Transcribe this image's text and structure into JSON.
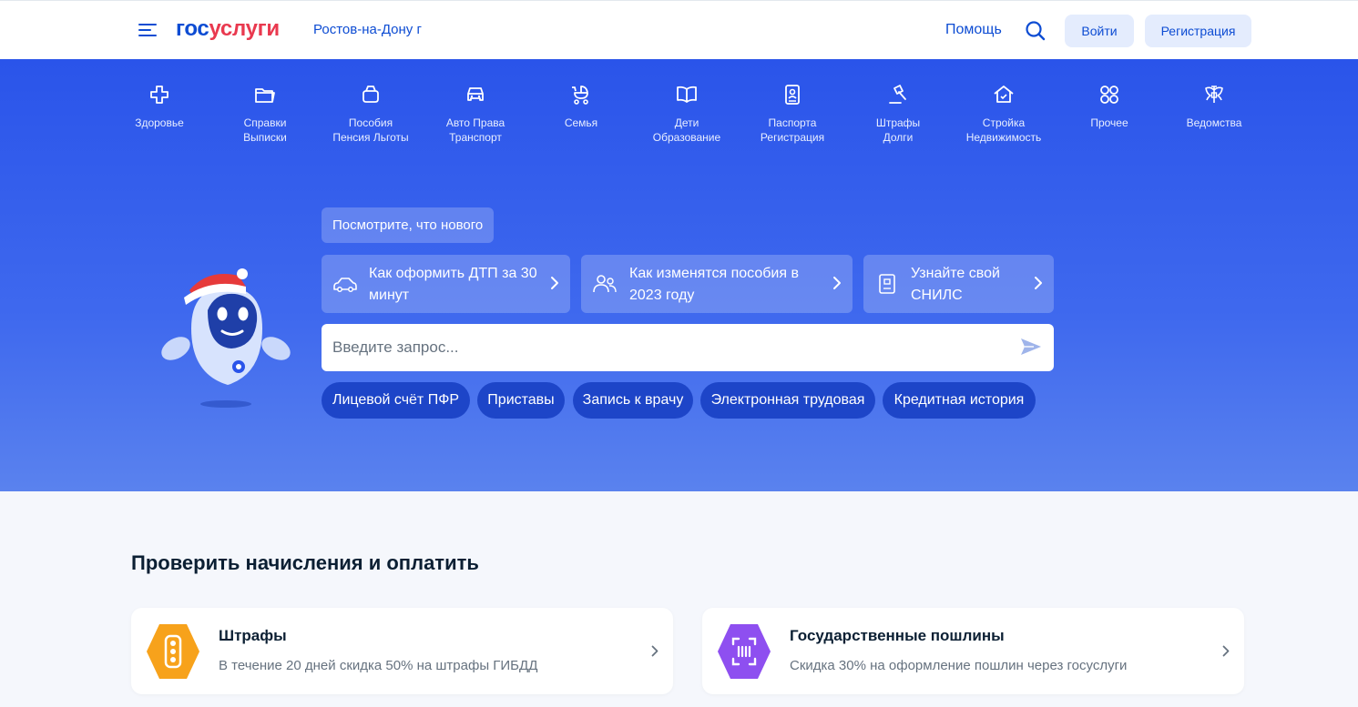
{
  "header": {
    "logo_part1": "гос",
    "logo_part2": "услуги",
    "city": "Ростов-на-Дону г",
    "help": "Помощь",
    "login": "Войти",
    "register": "Регистрация"
  },
  "categories": [
    {
      "line1": "Здоровье",
      "line2": "",
      "icon": "health-cross-icon"
    },
    {
      "line1": "Справки",
      "line2": "Выписки",
      "icon": "folder-icon"
    },
    {
      "line1": "Пособия",
      "line2": "Пенсия Льготы",
      "icon": "wallet-icon"
    },
    {
      "line1": "Авто Права",
      "line2": "Транспорт",
      "icon": "car-icon"
    },
    {
      "line1": "Семья",
      "line2": "",
      "icon": "stroller-icon"
    },
    {
      "line1": "Дети",
      "line2": "Образование",
      "icon": "book-icon"
    },
    {
      "line1": "Паспорта",
      "line2": "Регистрация",
      "icon": "passport-icon"
    },
    {
      "line1": "Штрафы",
      "line2": "Долги",
      "icon": "gavel-icon"
    },
    {
      "line1": "Стройка",
      "line2": "Недвижимость",
      "icon": "house-icon"
    },
    {
      "line1": "Прочее",
      "line2": "",
      "icon": "grid-icon"
    },
    {
      "line1": "Ведомства",
      "line2": "",
      "icon": "coat-of-arms-icon"
    }
  ],
  "hero": {
    "whats_new": "Посмотрите, что нового",
    "news": [
      {
        "line1": "Как оформить ДТП за 30",
        "line2": "минут",
        "icon": "car-outline-icon"
      },
      {
        "line1": "Как изменятся пособия в",
        "line2": "2023 году",
        "icon": "people-icon"
      },
      {
        "line1": "Узнайте свой",
        "line2": "СНИЛС",
        "icon": "id-card-icon"
      }
    ],
    "search_placeholder": "Введите запрос...",
    "chips": [
      "Лицевой счёт ПФР",
      "Приставы",
      "Запись к врачу",
      "Электронная трудовая",
      "Кредитная история"
    ]
  },
  "section": {
    "title": "Проверить начисления и оплатить",
    "cards": [
      {
        "title": "Штрафы",
        "subtitle": "В течение 20 дней скидка 50% на штрафы ГИБДД",
        "icon": "traffic-light-icon",
        "color": "#f7a21b"
      },
      {
        "title": "Государственные пошлины",
        "subtitle": "Скидка 30% на оформление пошлин через госуслуги",
        "icon": "barcode-scan-icon",
        "color": "#8e4ff0"
      }
    ]
  },
  "colors": {
    "brand_blue": "#0d4cd3",
    "brand_red": "#e9394f",
    "hero_blue": "#2a54ea",
    "chip_blue": "#1d45c8"
  }
}
